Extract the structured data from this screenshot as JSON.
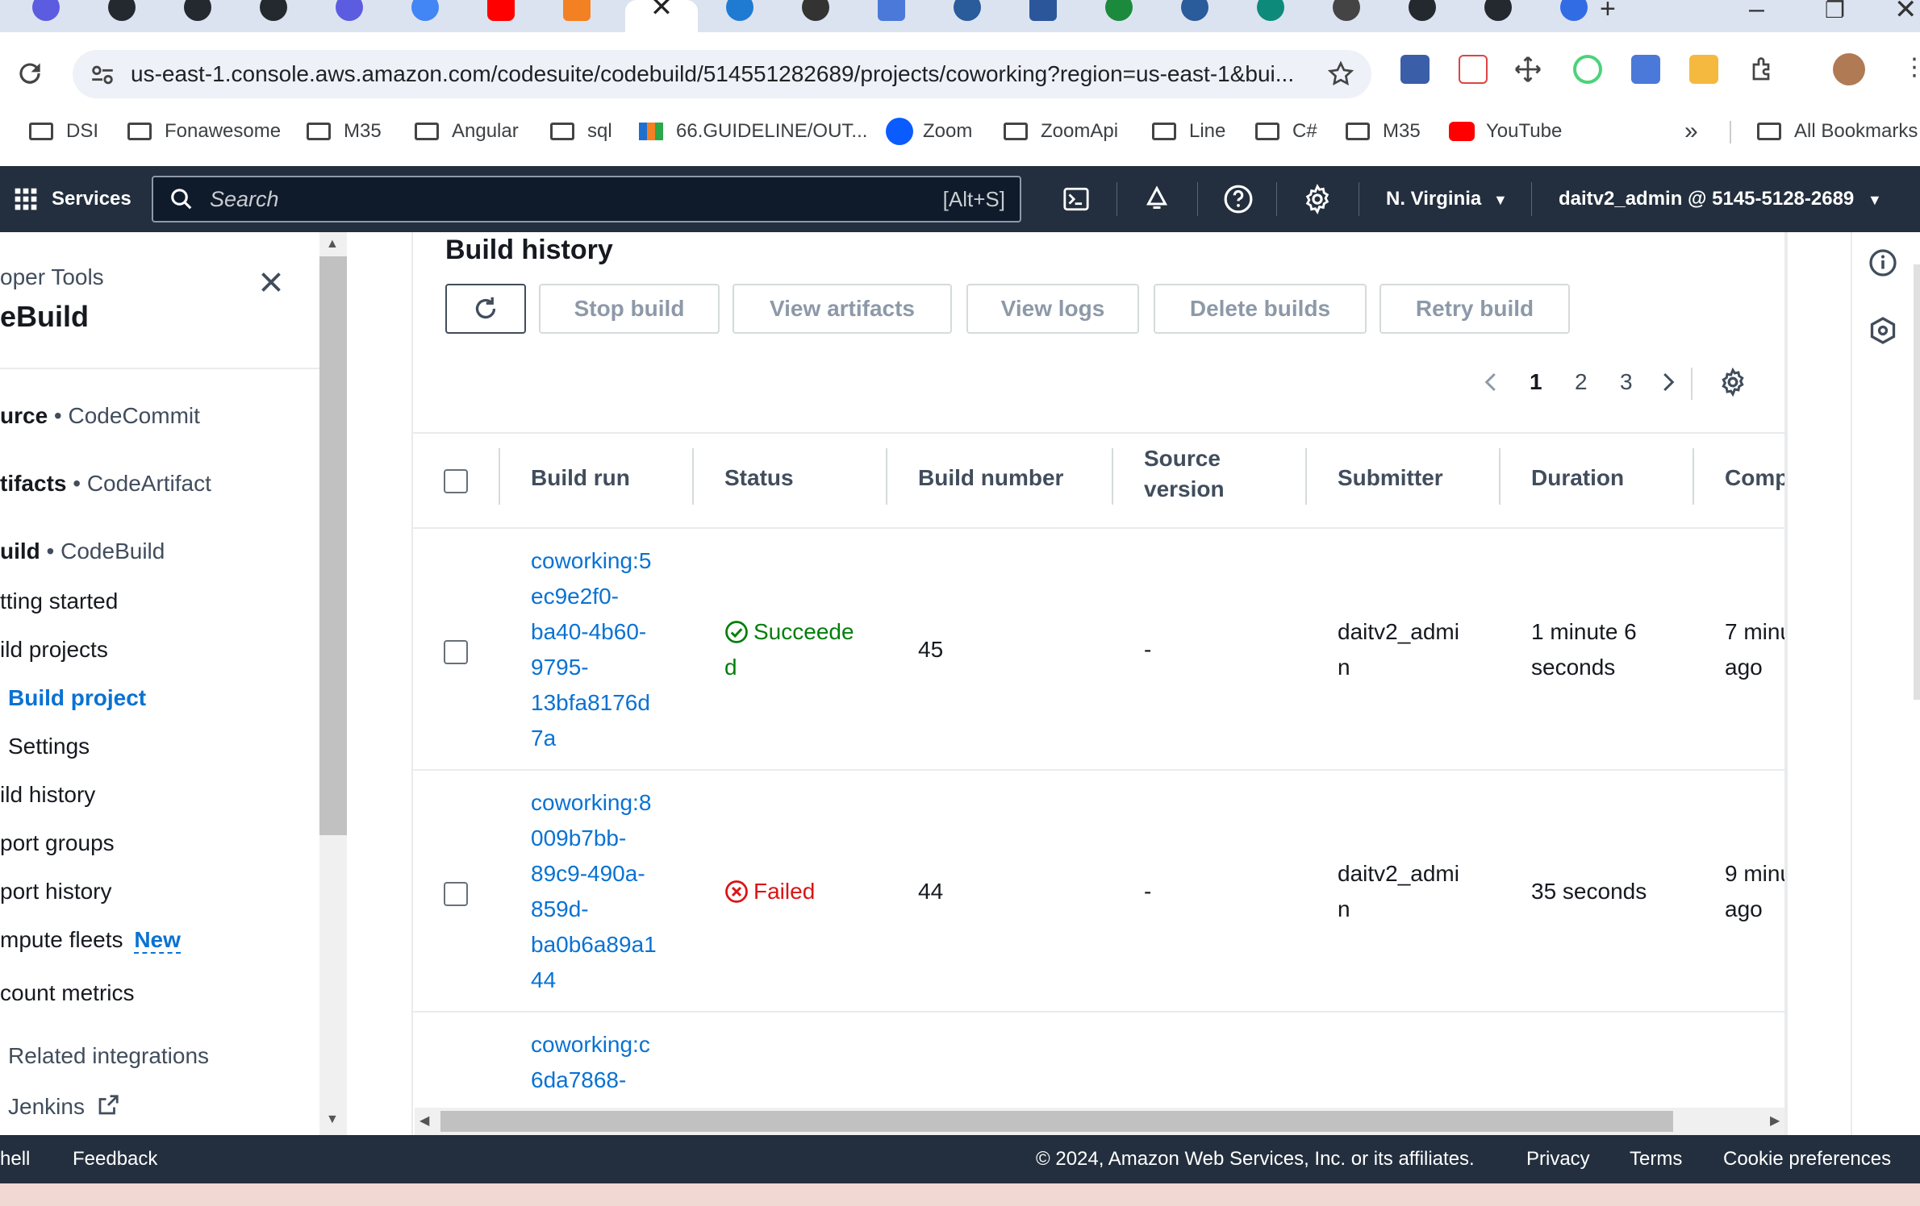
{
  "browser": {
    "url": "us-east-1.console.aws.amazon.com/codesuite/codebuild/514551282689/projects/coworking?region=us-east-1&bui...",
    "bookmarks": [
      "DSI",
      "Fonawesome",
      "M35",
      "Angular",
      "sql",
      "66.GUIDELINE/OUT...",
      "Zoom",
      "ZoomApi",
      "Line",
      "C#",
      "M35",
      "YouTube"
    ],
    "all_bookmarks": "All Bookmarks",
    "tab_icons": [
      "opera-icon",
      "github-icon",
      "github-icon",
      "github-icon",
      "opera-icon",
      "google-icon",
      "youtube-icon",
      "stackoverflow-icon",
      "active-close-icon",
      "edge-icon",
      "openai-icon",
      "translate-icon",
      "edge-icon",
      "word-icon",
      "excel-icon",
      "edge-icon",
      "edge-icon",
      "github-icon",
      "github-icon",
      "github-icon",
      "kubernetes-icon"
    ]
  },
  "aws_nav": {
    "services": "Services",
    "search_placeholder": "Search",
    "search_shortcut": "[Alt+S]",
    "region": "N. Virginia",
    "account": "daitv2_admin @ 5145-5128-2689"
  },
  "sidebar": {
    "header_small": "oper Tools",
    "header_big": "eBuild",
    "items": [
      {
        "bold": "urce",
        "rest": " • CodeCommit"
      },
      {
        "bold": "tifacts",
        "rest": " • CodeArtifact"
      },
      {
        "bold": "uild",
        "rest": " • CodeBuild"
      }
    ],
    "links": [
      "tting started",
      "ild projects",
      "Build project",
      "Settings",
      "ild history",
      "port groups",
      "port history",
      "mpute fleets",
      "count metrics"
    ],
    "new_badge": "New",
    "related": "Related integrations",
    "jenkins": "Jenkins"
  },
  "main": {
    "title": "Build history",
    "buttons": {
      "stop": "Stop build",
      "artifacts": "View artifacts",
      "logs": "View logs",
      "delete": "Delete builds",
      "retry": "Retry build"
    },
    "pagination": {
      "pages": [
        "1",
        "2",
        "3"
      ],
      "current": "1"
    },
    "columns": {
      "build_run": "Build run",
      "status": "Status",
      "build_number": "Build number",
      "source_version_1": "Source",
      "source_version_2": "version",
      "submitter": "Submitter",
      "duration": "Duration",
      "completed": "Comp"
    },
    "rows": [
      {
        "build_run": [
          "coworking:5",
          "ec9e2f0-",
          "ba40-4b60-",
          "9795-",
          "13bfa8176d",
          "7a"
        ],
        "status": [
          "Succeede",
          "d"
        ],
        "status_kind": "success",
        "build_number": "45",
        "source_version": "-",
        "submitter": [
          "daitv2_admi",
          "n"
        ],
        "duration": [
          "1 minute 6",
          "seconds"
        ],
        "completed": [
          "7 minu",
          "ago"
        ]
      },
      {
        "build_run": [
          "coworking:8",
          "009b7bb-",
          "89c9-490a-",
          "859d-",
          "ba0b6a89a1",
          "44"
        ],
        "status": [
          "Failed"
        ],
        "status_kind": "failed",
        "build_number": "44",
        "source_version": "-",
        "submitter": [
          "daitv2_admi",
          "n"
        ],
        "duration": [
          "35 seconds"
        ],
        "completed": [
          "9 minu",
          "ago"
        ]
      },
      {
        "build_run": [
          "coworking:c",
          "6da7868-"
        ]
      }
    ]
  },
  "footer": {
    "cloudshell": "hell",
    "feedback": "Feedback",
    "copyright": "© 2024, Amazon Web Services, Inc. or its affiliates.",
    "privacy": "Privacy",
    "terms": "Terms",
    "cookies": "Cookie preferences"
  },
  "colors": {
    "aws_nav": "#232f3e",
    "link": "#0972d3",
    "success": "#037f0c",
    "error": "#d91515"
  }
}
